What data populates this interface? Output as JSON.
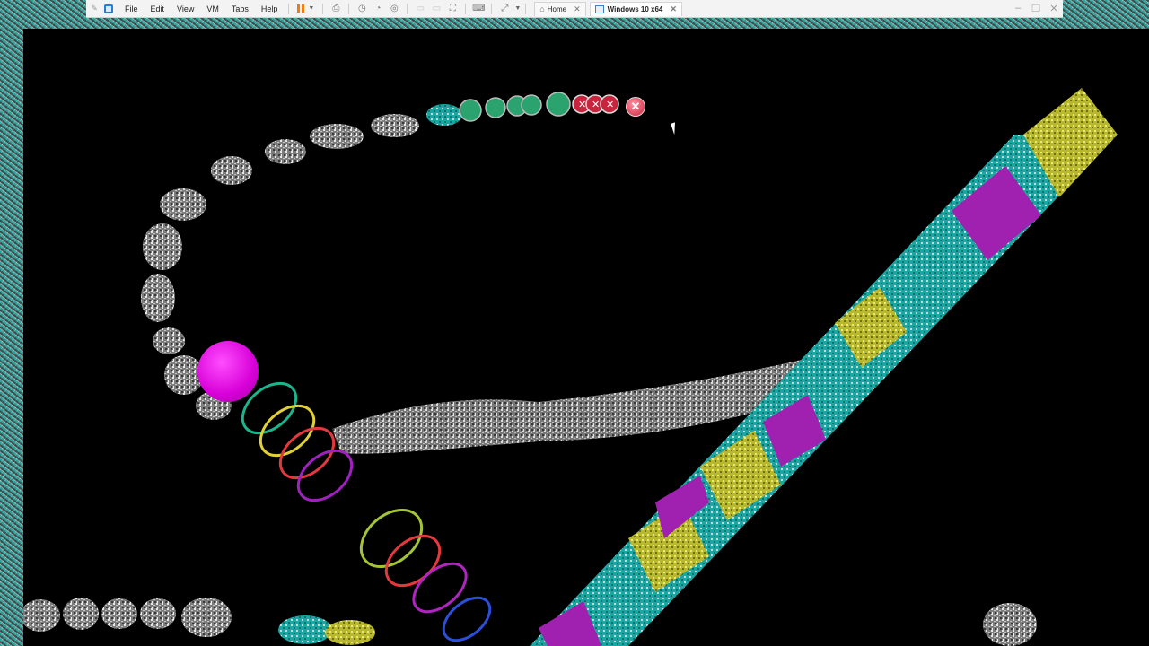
{
  "toolbar": {
    "menus": [
      "File",
      "Edit",
      "View",
      "VM",
      "Tabs",
      "Help"
    ],
    "tabs": [
      {
        "label": "Home",
        "active": false
      },
      {
        "label": "Windows 10 x64",
        "active": true
      }
    ],
    "icons": [
      "pin-icon",
      "vmware-logo-icon",
      "pause-icon",
      "send-keys-icon",
      "snapshot-icon",
      "revert-snapshot-icon",
      "snapshot-manager-icon",
      "unity-icon",
      "console-view-icon",
      "fullscreen-icon",
      "terminal-icon",
      "stretch-icon",
      "minimize-icon",
      "restore-icon",
      "close-icon"
    ],
    "accent": "#f07a16"
  },
  "game": {
    "title": "",
    "ball_colors": {
      "magenta": "#d800d8",
      "red": "#c9243d",
      "green": "#2aa36e",
      "gray": "#9a9a9a",
      "cyan": "#19b5b5",
      "yellow": "#c8c62e",
      "purple": "#8a1fb0"
    },
    "launcher_ball_color": "magenta",
    "next_ball_color": "red"
  }
}
